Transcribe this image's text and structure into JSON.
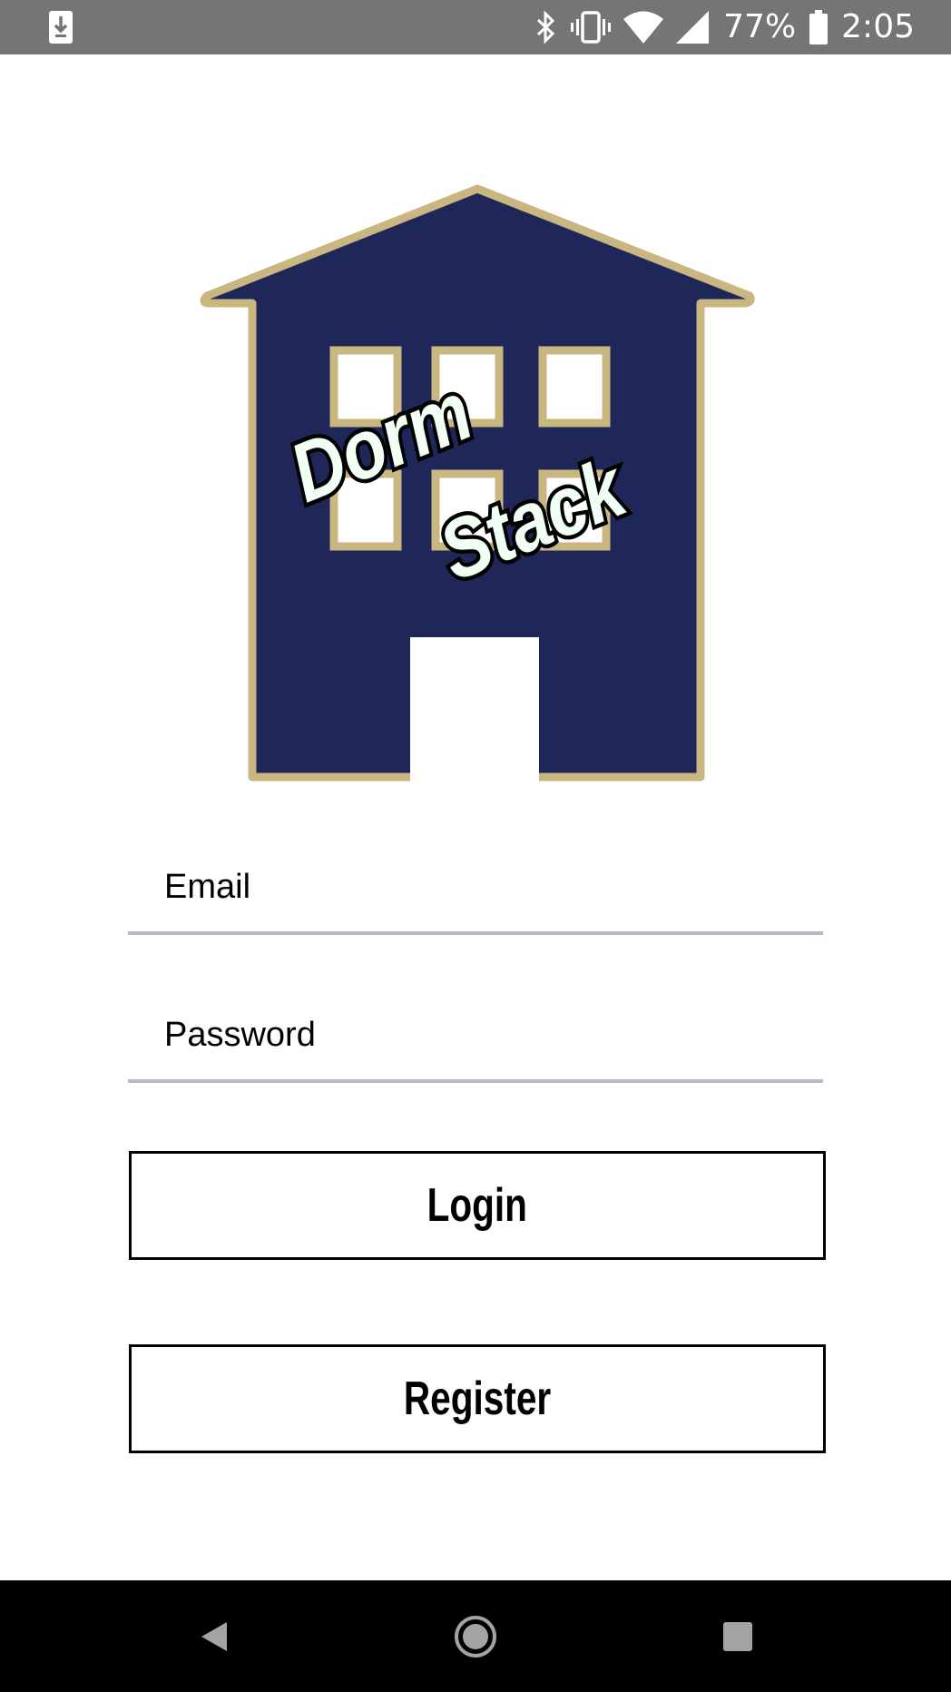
{
  "status_bar": {
    "battery_percent": "77%",
    "time": "2:05",
    "icons": [
      "download-notification-icon",
      "bluetooth-icon",
      "vibrate-icon",
      "wifi-icon",
      "cellular-signal-icon",
      "battery-icon"
    ]
  },
  "logo": {
    "text_line1": "Dorm",
    "text_line2": "Stack",
    "colors": {
      "navy": "#1e2757",
      "gold": "#c9b681",
      "window_fill": "#ffffff"
    }
  },
  "form": {
    "email_placeholder": "Email",
    "password_placeholder": "Password",
    "login_label": "Login",
    "register_label": "Register"
  },
  "nav_bar": {
    "icons": [
      "back-icon",
      "home-icon",
      "recents-icon"
    ]
  }
}
